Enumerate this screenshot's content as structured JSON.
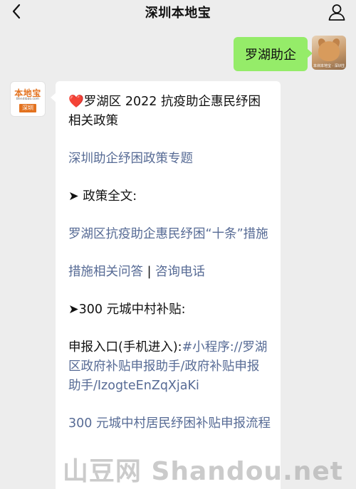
{
  "header": {
    "title": "深圳本地宝",
    "back_icon": "chevron-left-icon",
    "profile_icon": "person-icon"
  },
  "outgoing": {
    "text": "罗湖助企",
    "bubble_color": "#95ec69",
    "avatar_caption": "本圳本地宝 · 深圳生活"
  },
  "bot": {
    "logo_main": "本地宝",
    "logo_url": "Bendibao.com",
    "logo_city": "深圳"
  },
  "message": {
    "heart": "❤️",
    "title": "罗湖区 2022 抗疫助企惠民纾困相关政策",
    "link_special": "深圳助企纾困政策专题",
    "section1": "➤ 政策全文:",
    "link_measures": "罗湖区抗疫助企惠民纾困“十条”措施",
    "link_qa": "措施相关问答",
    "separator": " | ",
    "link_phone": "咨询电话",
    "section2": "➤300 元城中村补贴:",
    "entry_label": "申报入口(手机进入):",
    "link_miniprogram": "#小程序://罗湖区政府补贴申报助手/政府补贴申报助手/IzogteEnZqXjaKi",
    "link_process": "300 元城中村居民纾困补贴申报流程",
    "link_color": "#576b95"
  },
  "watermark": {
    "text": "山豆网 Shandou.net"
  }
}
